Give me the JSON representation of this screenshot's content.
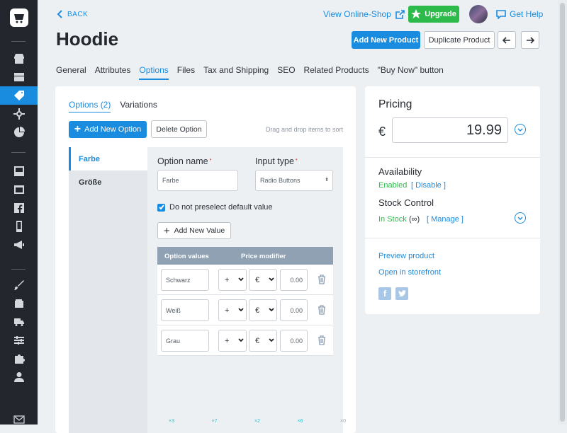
{
  "header": {
    "back_label": "BACK",
    "product_title": "Hoodie",
    "view_shop": "View Online-Shop",
    "upgrade": "Upgrade",
    "get_help": "Get Help",
    "add_new_product": "Add New Product",
    "duplicate_product": "Duplicate Product"
  },
  "tabs": [
    {
      "label": "General"
    },
    {
      "label": "Attributes"
    },
    {
      "label": "Options",
      "active": true
    },
    {
      "label": "Files"
    },
    {
      "label": "Tax and Shipping"
    },
    {
      "label": "SEO"
    },
    {
      "label": "Related Products"
    },
    {
      "label": "\"Buy Now\" button"
    }
  ],
  "options": {
    "subtabs": [
      {
        "label": "Options (2)",
        "active": true
      },
      {
        "label": "Variations"
      }
    ],
    "add_option": "Add New Option",
    "delete_option": "Delete Option",
    "drag_hint": "Drag and drop items to sort",
    "list": [
      {
        "label": "Farbe",
        "active": true
      },
      {
        "label": "Größe"
      }
    ],
    "option_name_label": "Option name",
    "option_name_value": "Farbe",
    "input_type_label": "Input type",
    "input_type_value": "Radio Buttons",
    "no_preselect": "Do not preselect default value",
    "add_value": "Add New Value",
    "col_values": "Option values",
    "col_modifier": "Price modifier",
    "values": [
      {
        "name": "Schwarz",
        "sign": "+",
        "currency": "€",
        "amount": "0.00"
      },
      {
        "name": "Weiß",
        "sign": "+",
        "currency": "€",
        "amount": "0.00"
      },
      {
        "name": "Grau",
        "sign": "+",
        "currency": "€",
        "amount": "0.00"
      }
    ],
    "counts": [
      "×3",
      "×7",
      "×2",
      "×6",
      "×0"
    ]
  },
  "pricing": {
    "title": "Pricing",
    "currency": "€",
    "price": "19.99",
    "availability_title": "Availability",
    "availability_status": "Enabled",
    "availability_action": "[ Disable ]",
    "stock_title": "Stock Control",
    "stock_status": "In Stock",
    "stock_infinity": "(∞)",
    "stock_action": "[ Manage ]",
    "preview": "Preview product",
    "open_storefront": "Open in storefront"
  },
  "colors": {
    "accent": "#1a8cdf",
    "success": "#2cbb4a",
    "sidebar": "#23272d"
  }
}
